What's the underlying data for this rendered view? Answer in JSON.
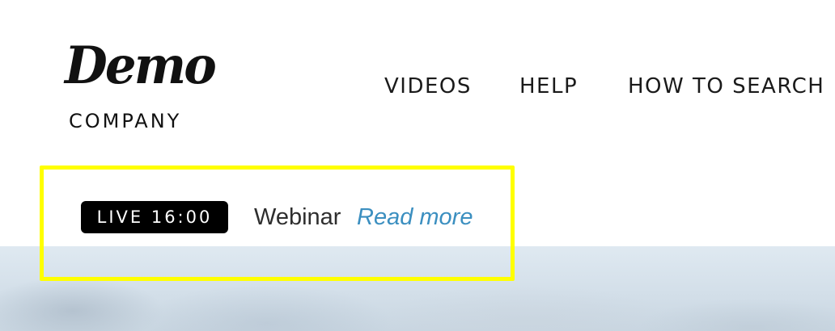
{
  "logo": {
    "script_text": "Demo",
    "sub_text": "COMPANY"
  },
  "nav": {
    "items": [
      {
        "label": "VIDEOS"
      },
      {
        "label": "HELP"
      },
      {
        "label": "HOW TO SEARCH"
      }
    ]
  },
  "announcement": {
    "badge": "LIVE 16:00",
    "text": "Webinar",
    "link_label": "Read more",
    "highlight_color": "#ffff00",
    "link_color": "#3b8fc0"
  }
}
